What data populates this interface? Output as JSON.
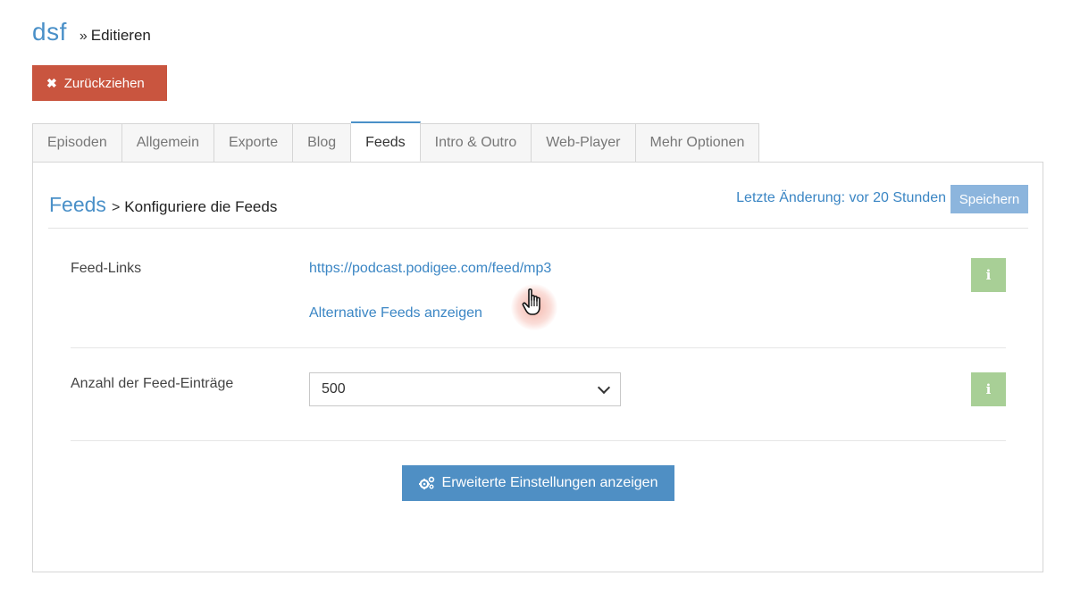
{
  "header": {
    "podcast_name": "dsf",
    "separator": "»",
    "current": "Editieren"
  },
  "actions": {
    "withdraw_icon": "✖",
    "withdraw_label": "Zurückziehen"
  },
  "tabs": [
    {
      "label": "Episoden",
      "active": false
    },
    {
      "label": "Allgemein",
      "active": false
    },
    {
      "label": "Exporte",
      "active": false
    },
    {
      "label": "Blog",
      "active": false
    },
    {
      "label": "Feeds",
      "active": true
    },
    {
      "label": "Intro & Outro",
      "active": false
    },
    {
      "label": "Web-Player",
      "active": false
    },
    {
      "label": "Mehr Optionen",
      "active": false
    }
  ],
  "panel": {
    "title": "Feeds",
    "separator": ">",
    "subtitle": "Konfiguriere die Feeds",
    "last_change": "Letzte Änderung: vor 20 Stunden",
    "save_label": "Speichern"
  },
  "feed_links": {
    "label": "Feed-Links",
    "url": "https://podcast.podigee.com/feed/mp3",
    "alt_link": "Alternative Feeds anzeigen",
    "info_icon": "i"
  },
  "feed_entries": {
    "label": "Anzahl der Feed-Einträge",
    "selected": "500",
    "info_icon": "i"
  },
  "advanced": {
    "label": "Erweiterte Einstellungen anzeigen",
    "icon": "gears-icon"
  },
  "colors": {
    "accent": "#4a90c8",
    "danger": "#c9553f",
    "info": "#a8cf96",
    "primary_button": "#4f8fc4"
  }
}
